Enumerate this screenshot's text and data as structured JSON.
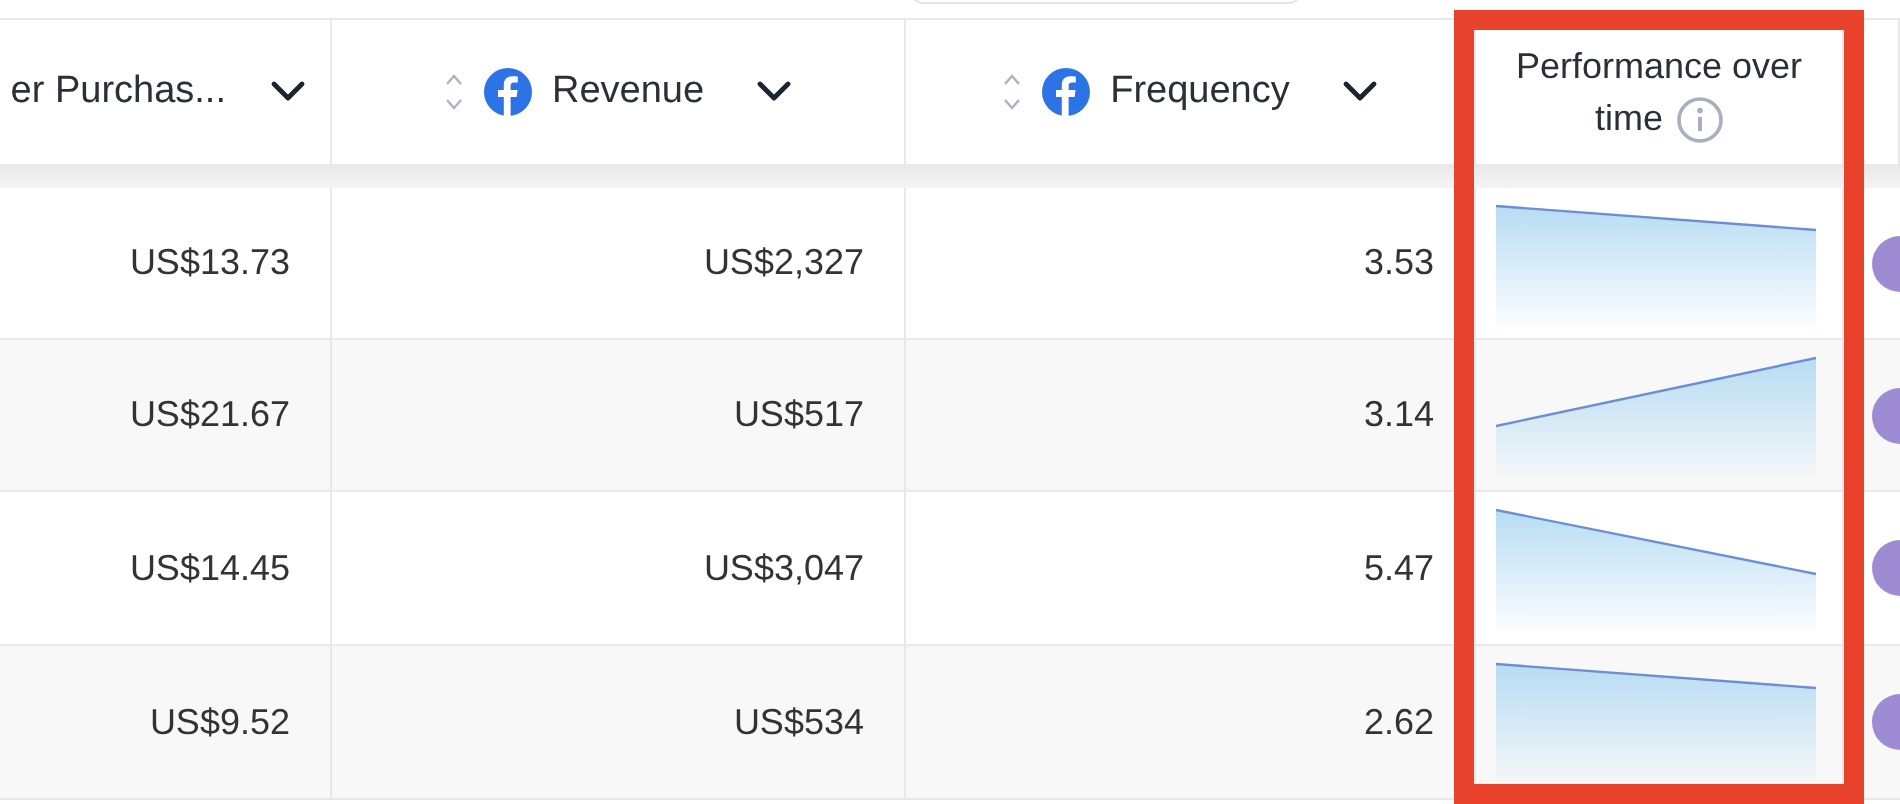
{
  "table": {
    "columns": [
      {
        "label": "er Purchas...",
        "kind": "cut"
      },
      {
        "label": "Revenue",
        "kind": "metric"
      },
      {
        "label": "Frequency",
        "kind": "metric"
      },
      {
        "label": "Performance over time",
        "kind": "trend"
      }
    ],
    "rows": [
      {
        "cells": [
          "US$13.73",
          "US$2,327",
          "3.53"
        ]
      },
      {
        "cells": [
          "US$21.67",
          "US$517",
          "3.14"
        ]
      },
      {
        "cells": [
          "US$14.45",
          "US$3,047",
          "5.47"
        ]
      },
      {
        "cells": [
          "US$9.52",
          "US$534",
          "2.62"
        ]
      }
    ]
  }
}
